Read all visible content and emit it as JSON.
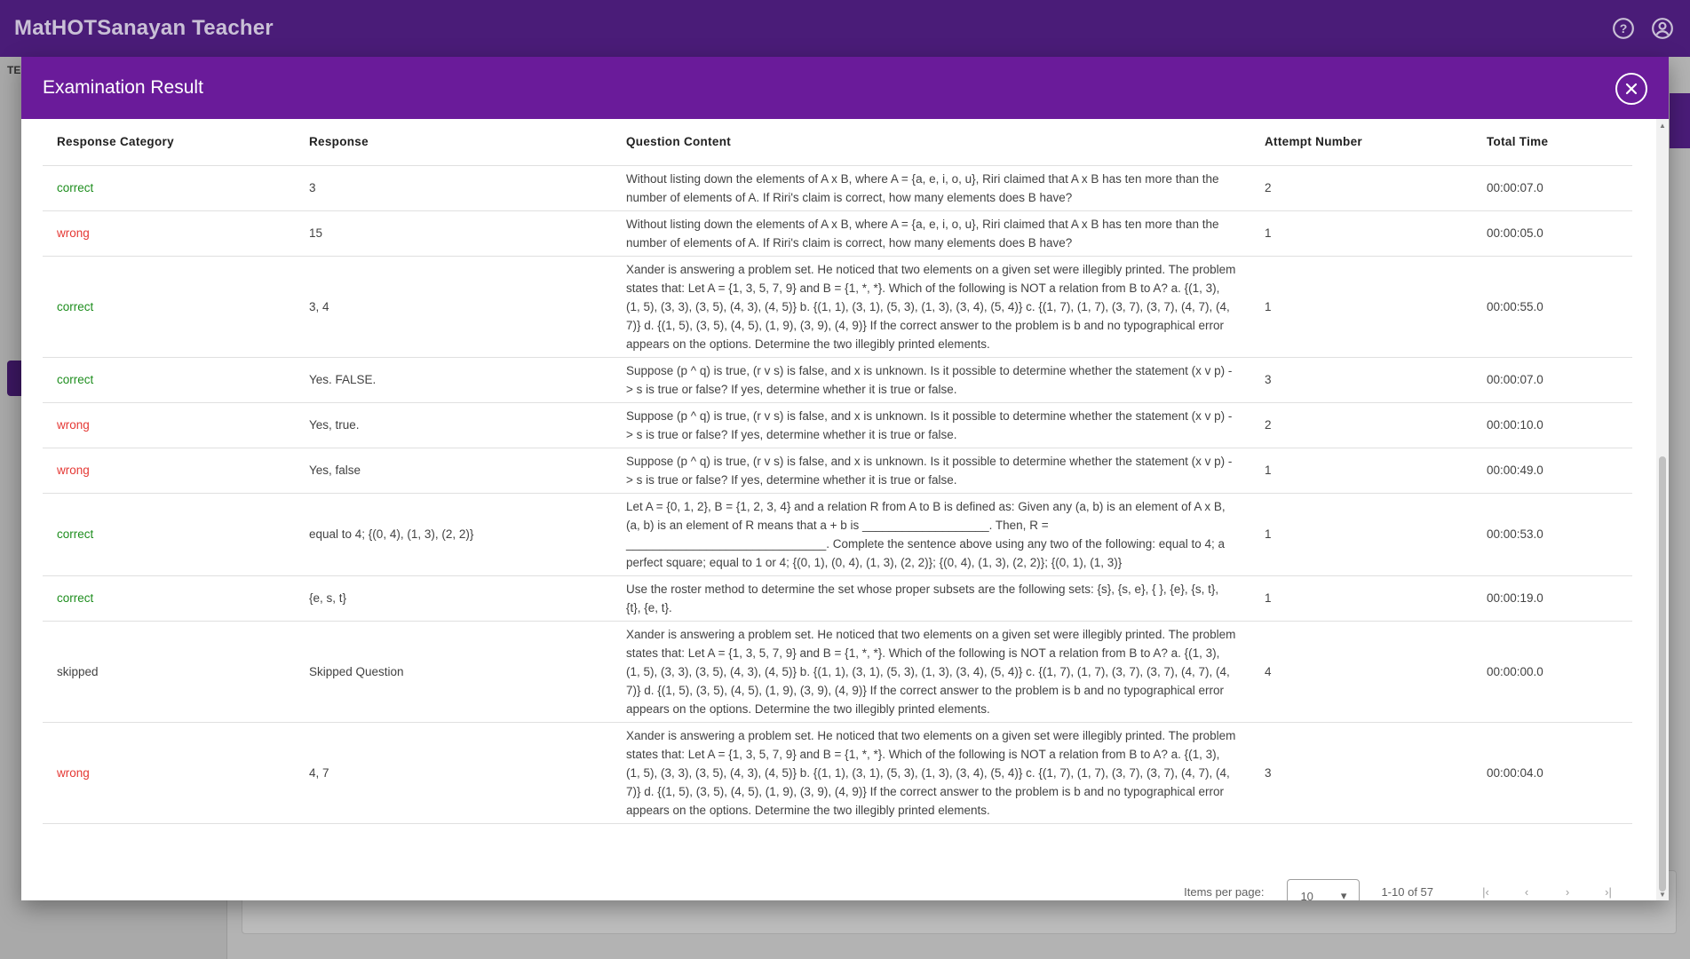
{
  "app": {
    "title": "MatHOTSanayan Teacher",
    "sidebar_stub": "TE"
  },
  "modal": {
    "title": "Examination Result",
    "columns": [
      "Response Category",
      "Response",
      "Question Content",
      "Attempt Number",
      "Total Time"
    ],
    "rows": [
      {
        "category": "correct",
        "response": "3",
        "question": "Without listing down the elements of A x B, where A = {a, e, i, o, u}, Riri claimed that A x B has ten more than the number of elements of A. If Riri's claim is correct, how many elements does B have?",
        "attempt": "2",
        "time": "00:00:07.0"
      },
      {
        "category": "wrong",
        "response": "15",
        "question": "Without listing down the elements of A x B, where A = {a, e, i, o, u}, Riri claimed that A x B has ten more than the number of elements of A. If Riri's claim is correct, how many elements does B have?",
        "attempt": "1",
        "time": "00:00:05.0"
      },
      {
        "category": "correct",
        "response": "3, 4",
        "question": "Xander is answering a problem set. He noticed that two elements on a given set were illegibly printed. The problem states that: Let A = {1, 3, 5, 7, 9} and B = {1, *, *}. Which of the following is NOT a relation from B to A? a. {(1, 3), (1, 5), (3, 3), (3, 5), (4, 3), (4, 5)} b. {(1, 1), (3, 1), (5, 3), (1, 3), (3, 4), (5, 4)} c. {(1, 7), (1, 7), (3, 7), (3, 7), (4, 7), (4, 7)} d. {(1, 5), (3, 5), (4, 5), (1, 9), (3, 9), (4, 9)} If the correct answer to the problem is b and no typographical error appears on the options. Determine the two illegibly printed elements.",
        "attempt": "1",
        "time": "00:00:55.0"
      },
      {
        "category": "correct",
        "response": "Yes. FALSE.",
        "question": "Suppose (p ^ q) is true, (r v s) is false, and x is unknown. Is it possible to determine whether the statement (x v p) -> s is true or false? If yes, determine whether it is true or false.",
        "attempt": "3",
        "time": "00:00:07.0"
      },
      {
        "category": "wrong",
        "response": "Yes, true.",
        "question": "Suppose (p ^ q) is true, (r v s) is false, and x is unknown. Is it possible to determine whether the statement (x v p) -> s is true or false? If yes, determine whether it is true or false.",
        "attempt": "2",
        "time": "00:00:10.0"
      },
      {
        "category": "wrong",
        "response": "Yes, false",
        "question": "Suppose (p ^ q) is true, (r v s) is false, and x is unknown. Is it possible to determine whether the statement (x v p) -> s is true or false? If yes, determine whether it is true or false.",
        "attempt": "1",
        "time": "00:00:49.0"
      },
      {
        "category": "correct",
        "response": "equal to 4; {(0, 4), (1, 3), (2, 2)}",
        "question": "Let A = {0, 1, 2}, B = {1, 2, 3, 4} and a relation R from A to B is defined as: Given any (a, b) is an element of A x B, (a, b) is an element of R means that a + b is ___________________. Then, R = ______________________________. Complete the sentence above using any two of the following: equal to 4; a perfect square; equal to 1 or 4; {(0, 1), (0, 4), (1, 3), (2, 2)}; {(0, 4), (1, 3), (2, 2)}; {(0, 1), (1, 3)}",
        "attempt": "1",
        "time": "00:00:53.0"
      },
      {
        "category": "correct",
        "response": "{e, s, t}",
        "question": "Use the roster method to determine the set whose proper subsets are the following sets: {s}, {s, e}, { }, {e}, {s, t}, {t}, {e, t}.",
        "attempt": "1",
        "time": "00:00:19.0"
      },
      {
        "category": "skipped",
        "response": "Skipped Question",
        "question": "Xander is answering a problem set. He noticed that two elements on a given set were illegibly printed. The problem states that: Let A = {1, 3, 5, 7, 9} and B = {1, *, *}. Which of the following is NOT a relation from B to A? a. {(1, 3), (1, 5), (3, 3), (3, 5), (4, 3), (4, 5)} b. {(1, 1), (3, 1), (5, 3), (1, 3), (3, 4), (5, 4)} c. {(1, 7), (1, 7), (3, 7), (3, 7), (4, 7), (4, 7)} d. {(1, 5), (3, 5), (4, 5), (1, 9), (3, 9), (4, 9)} If the correct answer to the problem is b and no typographical error appears on the options. Determine the two illegibly printed elements.",
        "attempt": "4",
        "time": "00:00:00.0"
      },
      {
        "category": "wrong",
        "response": "4, 7",
        "question": "Xander is answering a problem set. He noticed that two elements on a given set were illegibly printed. The problem states that: Let A = {1, 3, 5, 7, 9} and B = {1, *, *}. Which of the following is NOT a relation from B to A? a. {(1, 3), (1, 5), (3, 3), (3, 5), (4, 3), (4, 5)} b. {(1, 1), (3, 1), (5, 3), (1, 3), (3, 4), (5, 4)} c. {(1, 7), (1, 7), (3, 7), (3, 7), (4, 7), (4, 7)} d. {(1, 5), (3, 5), (4, 5), (1, 9), (3, 9), (4, 9)} If the correct answer to the problem is b and no typographical error appears on the options. Determine the two illegibly printed elements.",
        "attempt": "3",
        "time": "00:00:04.0"
      }
    ],
    "paginator": {
      "label": "Items per page:",
      "page_size": "10",
      "range": "1-10 of 57"
    }
  },
  "colors": {
    "appbar": "#4a1c78",
    "modal_header": "#6a1b9a",
    "correct": "#1e8e1e",
    "wrong": "#e53935"
  },
  "icons": {
    "help": "help-circle-icon",
    "account": "account-circle-icon",
    "close": "close-icon"
  }
}
